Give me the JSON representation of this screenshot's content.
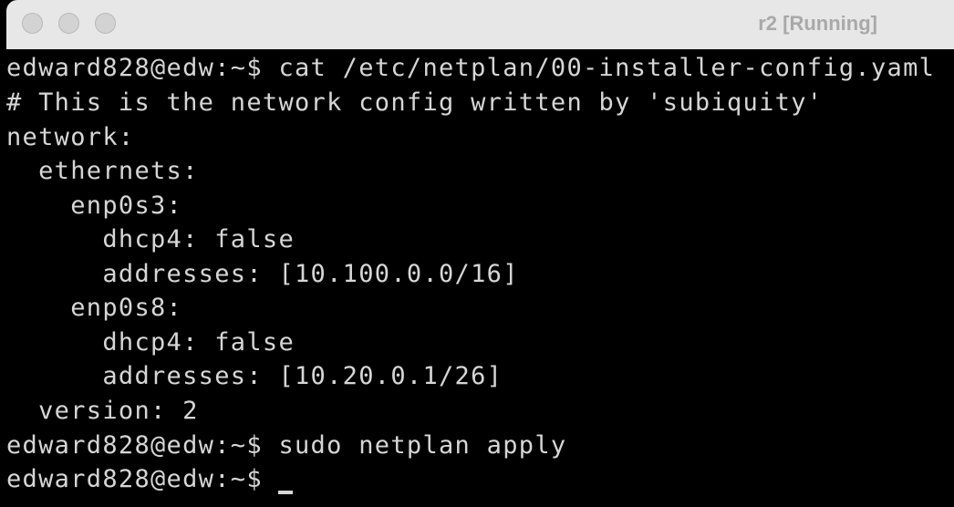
{
  "window": {
    "title": "r2 [Running]"
  },
  "terminal": {
    "lines": [
      "edward828@edw:~$ cat /etc/netplan/00-installer-config.yaml",
      "# This is the network config written by 'subiquity'",
      "network:",
      "  ethernets:",
      "    enp0s3:",
      "      dhcp4: false",
      "      addresses: [10.100.0.0/16]",
      "    enp0s8:",
      "      dhcp4: false",
      "      addresses: [10.20.0.1/26]",
      "  version: 2",
      "edward828@edw:~$ sudo netplan apply",
      "edward828@edw:~$ "
    ]
  }
}
